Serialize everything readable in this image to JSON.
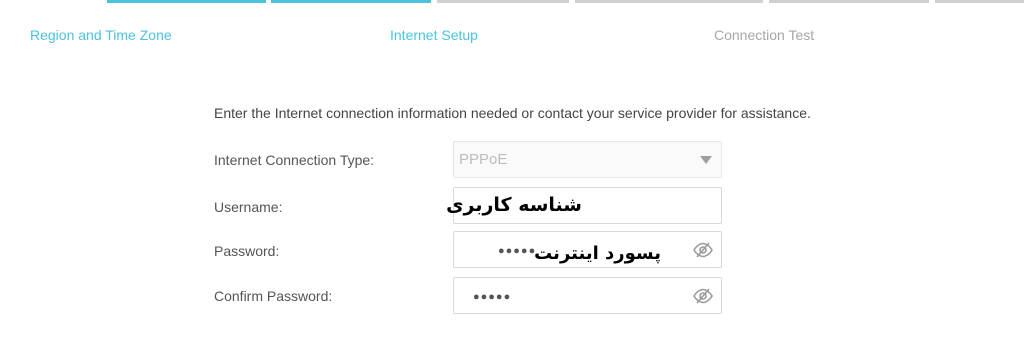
{
  "steps": [
    {
      "label": "Region and Time Zone",
      "state": "done"
    },
    {
      "label": "Internet Setup",
      "state": "current"
    },
    {
      "label": "Connection Test",
      "state": "pending"
    }
  ],
  "colors": {
    "accent": "#4bc3dc",
    "inactive": "#d0d0d0",
    "pending_text": "#a6a6a6"
  },
  "form": {
    "intro": "Enter the Internet connection information needed or contact your service provider for assistance.",
    "connection_type": {
      "label": "Internet Connection Type:",
      "value": "PPPoE",
      "disabled": true
    },
    "username": {
      "label": "Username:",
      "overlay": "شناسه کاربری"
    },
    "password": {
      "label": "Password:",
      "mask": "●●●●●",
      "overlay": "پسورد اینترنت",
      "icon": "eye-slash-icon"
    },
    "confirm_password": {
      "label": "Confirm Password:",
      "mask": "●●●●●",
      "icon": "eye-slash-icon"
    }
  }
}
